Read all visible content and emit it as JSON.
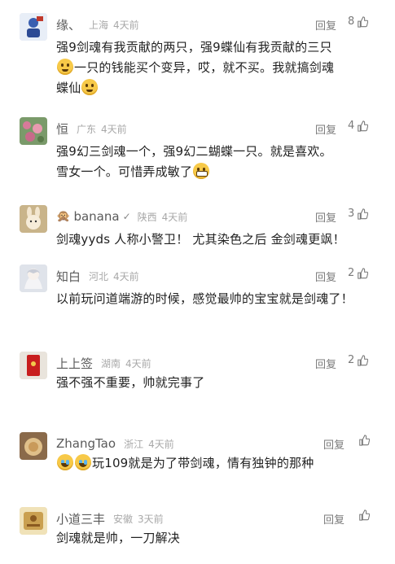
{
  "ui": {
    "reply_label": "回复",
    "colors": {
      "username": "#5a5a5a",
      "meta": "#a8a8a8",
      "text": "#222222"
    }
  },
  "comments": [
    {
      "username": "缘、",
      "region": "上海",
      "time": "4天前",
      "likes": "8",
      "avatar_icon": "blue-character-icon",
      "text_parts": [
        "强9剑魂有我贡献的两只，强9蝶仙有我贡献的三只",
        "一只的钱能买个变异，哎，就不买。我就搞剑魂",
        "蝶仙"
      ],
      "emojis": [
        "embarrassed-emoji",
        "embarrassed-emoji"
      ]
    },
    {
      "username": "恒",
      "region": "广东",
      "time": "4天前",
      "likes": "4",
      "avatar_icon": "flowers-photo-icon",
      "text_parts": [
        "强9幻三剑魂一个，强9幻二蝴蝶一只。就是喜欢。",
        "雪女一个。可惜弄成敏了"
      ],
      "emojis": [
        "grin-emoji"
      ]
    },
    {
      "username": "banana",
      "region": "陕西",
      "time": "4天前",
      "likes": "3",
      "avatar_icon": "cartoon-rabbit-icon",
      "text": "剑魂yyds 人称小警卫！ 尤其染色之后 金剑魂更飒！"
    },
    {
      "username": "知白",
      "region": "河北",
      "time": "4天前",
      "likes": "2",
      "avatar_icon": "anime-character-icon",
      "text": "以前玩问道端游的时候，感觉最帅的宝宝就是剑魂了！"
    },
    {
      "username": "上上签",
      "region": "湖南",
      "time": "4天前",
      "likes": "2",
      "avatar_icon": "red-envelope-icon",
      "text": "强不强不重要，帅就完事了"
    },
    {
      "username": "ZhangTao",
      "region": "浙江",
      "time": "4天前",
      "likes": "",
      "avatar_icon": "food-photo-icon",
      "text_parts": [
        "",
        "玩109就是为了带剑魂，情有独钟的那种"
      ],
      "emojis": [
        "tears-of-joy-emoji",
        "tears-of-joy-emoji"
      ]
    },
    {
      "username": "小道三丰",
      "region": "安徽",
      "time": "3天前",
      "likes": "",
      "avatar_icon": "stamp-logo-icon",
      "text": "剑魂就是帅，一刀解决"
    }
  ]
}
